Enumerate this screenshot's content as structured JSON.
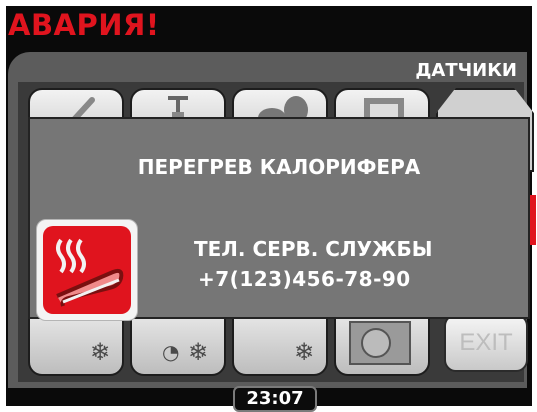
{
  "alarm": {
    "title": "АВАРИЯ!"
  },
  "section": {
    "title": "ДАТЧИКИ"
  },
  "dialog": {
    "message": "ПЕРЕГРЕВ КАЛОРИФЕРА",
    "service_label": "ТЕЛ. СЕРВ. СЛУЖБЫ",
    "service_phone": "+7(123)456-78-90",
    "icon": "heater-overheat-icon"
  },
  "buttons": {
    "exit_label": "EXIT"
  },
  "status": {
    "time": "23:07"
  },
  "colors": {
    "alarm": "#e0141e",
    "panel": "#5c5c5c",
    "dialog": "#767676",
    "background": "#0a0a0a"
  }
}
